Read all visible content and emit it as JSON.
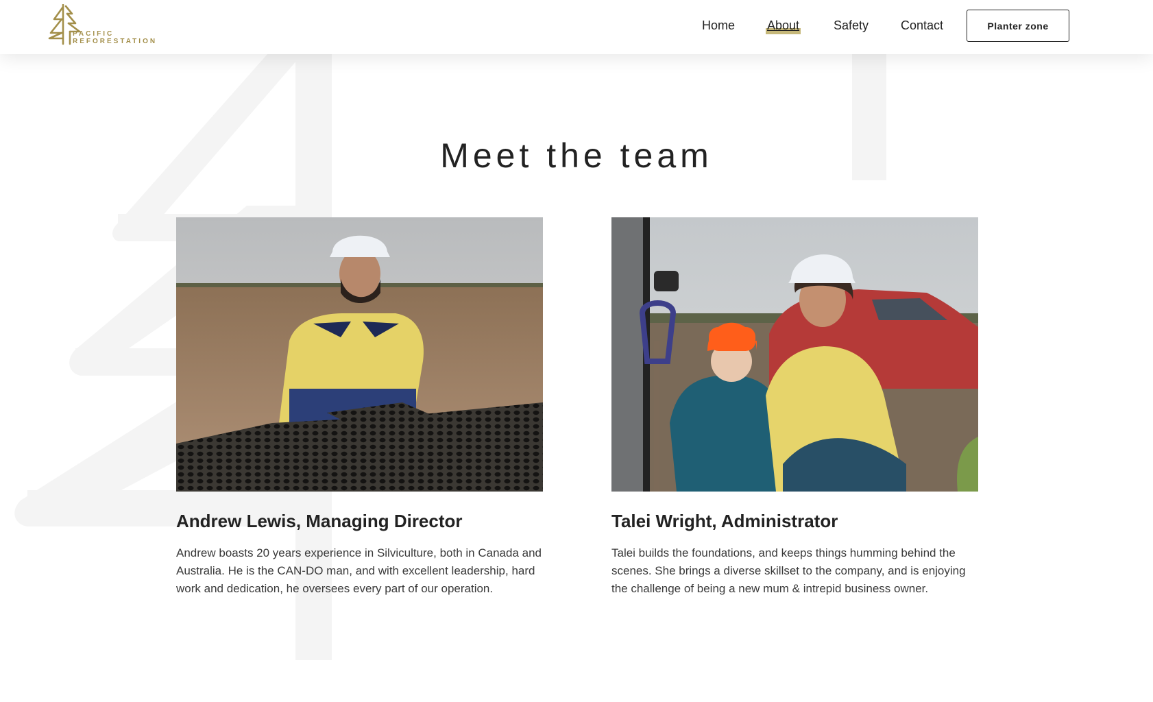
{
  "brand": {
    "line1": "PACIFIC",
    "line2": "REFORESTATION",
    "accent_color": "#a38f4a"
  },
  "nav": {
    "items": [
      {
        "label": "Home",
        "active": false
      },
      {
        "label": "About",
        "active": true
      },
      {
        "label": "Safety",
        "active": false
      },
      {
        "label": "Contact",
        "active": false
      }
    ],
    "cta_label": "Planter zone",
    "active_highlight_color": "#c6b87a"
  },
  "section": {
    "title": "Meet the team"
  },
  "team": [
    {
      "name": "Andrew Lewis, Managing Director",
      "bio": "Andrew boasts 20 years experience in Silviculture, both in Canada and Australia. He is the CAN-DO man, and with excellent leadership, hard work and dedication, he oversees every part of our operation.",
      "photo_icon": "team-photo-andrew"
    },
    {
      "name": "Talei Wright, Administrator",
      "bio": "Talei builds the foundations, and keeps things humming behind the scenes. She brings a diverse skillset to the company, and is enjoying the challenge of being a new mum & intrepid business owner.",
      "photo_icon": "team-photo-talei"
    }
  ]
}
